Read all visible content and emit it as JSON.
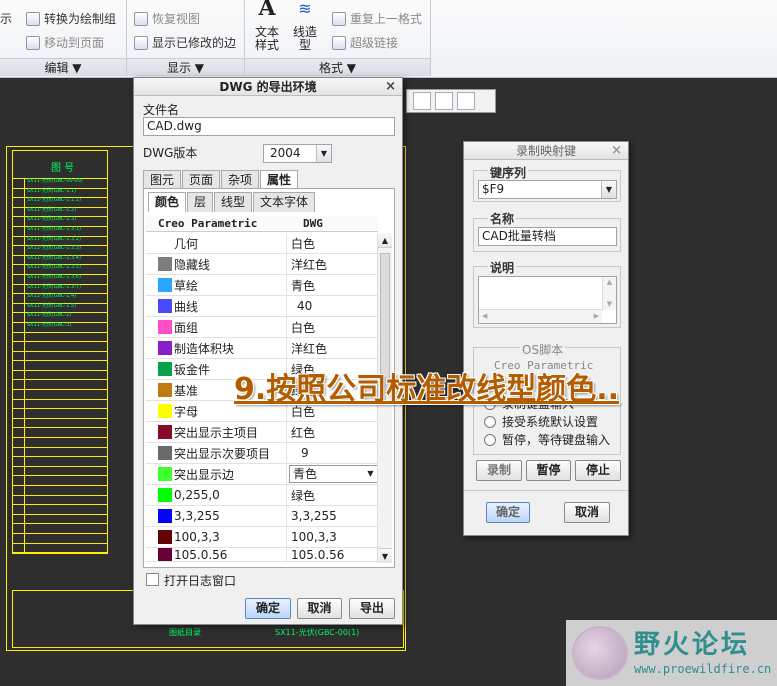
{
  "ribbon": {
    "cut_left": "示",
    "convert_to_drawn": "转换为绘制组",
    "move_to_page": "移动到页面",
    "restore_view": "恢复视图",
    "show_modified_edges": "显示已修改的边",
    "text_style": "文本\n样式",
    "line_style": "线造\n型",
    "repeat_last_format": "重复上一格式",
    "hyperlink": "超级链接",
    "groups": [
      "编辑 ▼",
      "显示 ▼",
      "格式 ▼"
    ]
  },
  "dwg_dialog": {
    "title": "DWG 的导出环境",
    "filename_label": "文件名",
    "filename_value": "CAD.dwg",
    "version_label": "DWG版本",
    "version_value": "2004",
    "tabs_top": [
      "图元",
      "页面",
      "杂项",
      "属性"
    ],
    "tabs_sub": [
      "颜色",
      "层",
      "线型",
      "文本字体"
    ],
    "col_creo": "Creo Parametric",
    "col_dwg": "DWG",
    "rows": [
      {
        "name": "几何",
        "value": "白色",
        "color": ""
      },
      {
        "name": "隐藏线",
        "value": "洋红色",
        "color": "#7d7d7d"
      },
      {
        "name": "草绘",
        "value": "青色",
        "color": "#2aa7ff"
      },
      {
        "name": "曲线",
        "value": "40",
        "color": "#4a4aff"
      },
      {
        "name": "面组",
        "value": "白色",
        "color": "#ff4fc7"
      },
      {
        "name": "制造体积块",
        "value": "洋红色",
        "color": "#8a1fc9"
      },
      {
        "name": "钣金件",
        "value": "绿色",
        "color": "#0aa04a"
      },
      {
        "name": "基准",
        "value": "绿色",
        "color": "#c07a10"
      },
      {
        "name": "字母",
        "value": "白色",
        "color": "#ffff00"
      },
      {
        "name": "突出显示主项目",
        "value": "红色",
        "color": "#8a0a2a"
      },
      {
        "name": "突出显示次要项目",
        "value": "9",
        "color": "#6a6a6a"
      },
      {
        "name": "突出显示边",
        "value": "青色",
        "color": "#40ff30"
      },
      {
        "name": "0,255,0",
        "value": "绿色",
        "color": "#00ff00"
      },
      {
        "name": "3,3,255",
        "value": "3,3,255",
        "color": "#0303ff"
      },
      {
        "name": "100,3,3",
        "value": "100,3,3",
        "color": "#640303"
      },
      {
        "name": "105.0.56",
        "value": "105.0.56",
        "color": "#690038"
      }
    ],
    "log_label": "打开日志窗口",
    "btn_ok": "确定",
    "btn_cancel": "取消",
    "btn_export": "导出"
  },
  "rec_dialog": {
    "title": "录制映射键",
    "key_label": "键序列",
    "key_value": "$F9",
    "name_label": "名称",
    "name_value": "CAD批量转档",
    "desc_label": "说明",
    "os_label": "OS脚本",
    "creo_label": "Creo Parametric",
    "radio_1": "录制键盘输入",
    "radio_2": "接受系统默认设置",
    "radio_3": "暂停，等待键盘输入",
    "btn_record": "录制",
    "btn_pause": "暂停",
    "btn_stop": "停止",
    "btn_ok": "确定",
    "btn_cancel": "取消"
  },
  "overlay": "9.按照公司标准改线型颜色..",
  "watermark": {
    "title": "野火论坛",
    "url": "www.proewildfire.cn"
  },
  "drawing": {
    "header": "图   号",
    "rows": [
      "SX11-光伏(GBC-00-00)",
      "SX11-光伏(GBC-1.1)",
      "SX11-光伏(GBC-1.1.1)",
      "SX11-光伏(GBC-1.2)",
      "SX11-光伏(GBC-1.3)",
      "SX11-光伏(GBC-1.3.1)",
      "SX11-光伏(GBC-1.3.2)",
      "SX11-光伏(GBC-1.3.3)",
      "SX11-光伏(GBC-1.3.4)",
      "SX11-光伏(GBC-1.3.5)",
      "SX11-光伏(GBC-1.3.6)",
      "SX11-光伏(GBC-1.3.7)",
      "SX11-光伏(GBC-1.4)",
      "SX11-光伏(GBC-1.5)",
      "SX11-光伏(GBC-2)",
      "SX11-光伏(GBC-3)"
    ],
    "bottom_title": "图纸目录",
    "bottom_code": "SX11-光伏(GBC-00(1)"
  }
}
